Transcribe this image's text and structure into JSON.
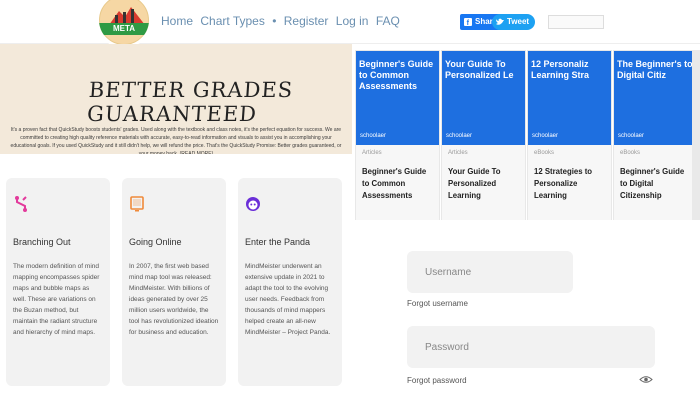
{
  "header": {
    "logo_text": "META",
    "nav": [
      "Home",
      "Chart Types",
      "•",
      "Register",
      "Log in",
      "FAQ"
    ],
    "share_label": "Share",
    "tweet_label": "Tweet",
    "mini_input_value": ""
  },
  "hero": {
    "headline": "BETTER GRADES GUARANTEED",
    "body": "It's a proven fact that QuickStudy boosts students' grades. Used along with the textbook and class notes, it's the perfect equation for success. We are committed to creating high quality reference materials with accurate, easy-to-read information and visuals to assist you in accomplishing your educational goals. If you used QuickStudy and it still didn't help, we will refund the price. That's the QuickStudy Promise: Better grades guaranteed, or your money back. (READ MORE)"
  },
  "cards": [
    {
      "title": "Branching Out",
      "text": "The modern definition of mind mapping encompasses spider maps and bubble maps as well. These are variations on the Buzan method, but maintain the radiant structure and hierarchy of mind maps."
    },
    {
      "title": "Going Online",
      "text": "In 2007, the first web based mind map tool was released: MindMeister. With billions of ideas generated by over 25 million users worldwide, the tool has revolutionized ideation for business and education."
    },
    {
      "title": "Enter the Panda",
      "text": "MindMeister underwent an extensive update in 2021 to adapt the tool to the evolving user needs. Feedback from thousands of mind mappers helped create an all-new MindMeister – Project Panda."
    }
  ],
  "articles": [
    {
      "type": "Articles",
      "title": "Beginner's Guide to Common Assessments",
      "thumb_title": "Beginner's Guide to Common Assessments",
      "brand": "schoolaer"
    },
    {
      "type": "Articles",
      "title": "Your Guide To Personalized Learning",
      "thumb_title": "Your Guide To Personalized Le",
      "brand": "schoolaer"
    },
    {
      "type": "eBooks",
      "title": "12 Strategies to Personalize Learning",
      "thumb_title": "12 Personaliz Learning Stra",
      "brand": "schoolaer"
    },
    {
      "type": "eBooks",
      "title": "Beginner's Guide to Digital Citizenship",
      "thumb_title": "The Beginner's to Digital Citiz",
      "brand": "schoolaer"
    }
  ],
  "login": {
    "username_placeholder": "Username",
    "forgot_username": "Forgot username",
    "password_placeholder": "Password",
    "forgot_password": "Forgot password"
  },
  "colors": {
    "share_blue": "#1877f2",
    "tweet_blue": "#1da1f2",
    "card_icon_pink": "#e33a9c",
    "card_icon_orange": "#f08a3a",
    "card_icon_purple": "#6b2fd8",
    "thumb_blue": "#1e6fe0"
  },
  "icons": [
    "facebook-icon",
    "twitter-icon",
    "branch-icon",
    "monitor-icon",
    "panda-icon",
    "eye-icon"
  ]
}
